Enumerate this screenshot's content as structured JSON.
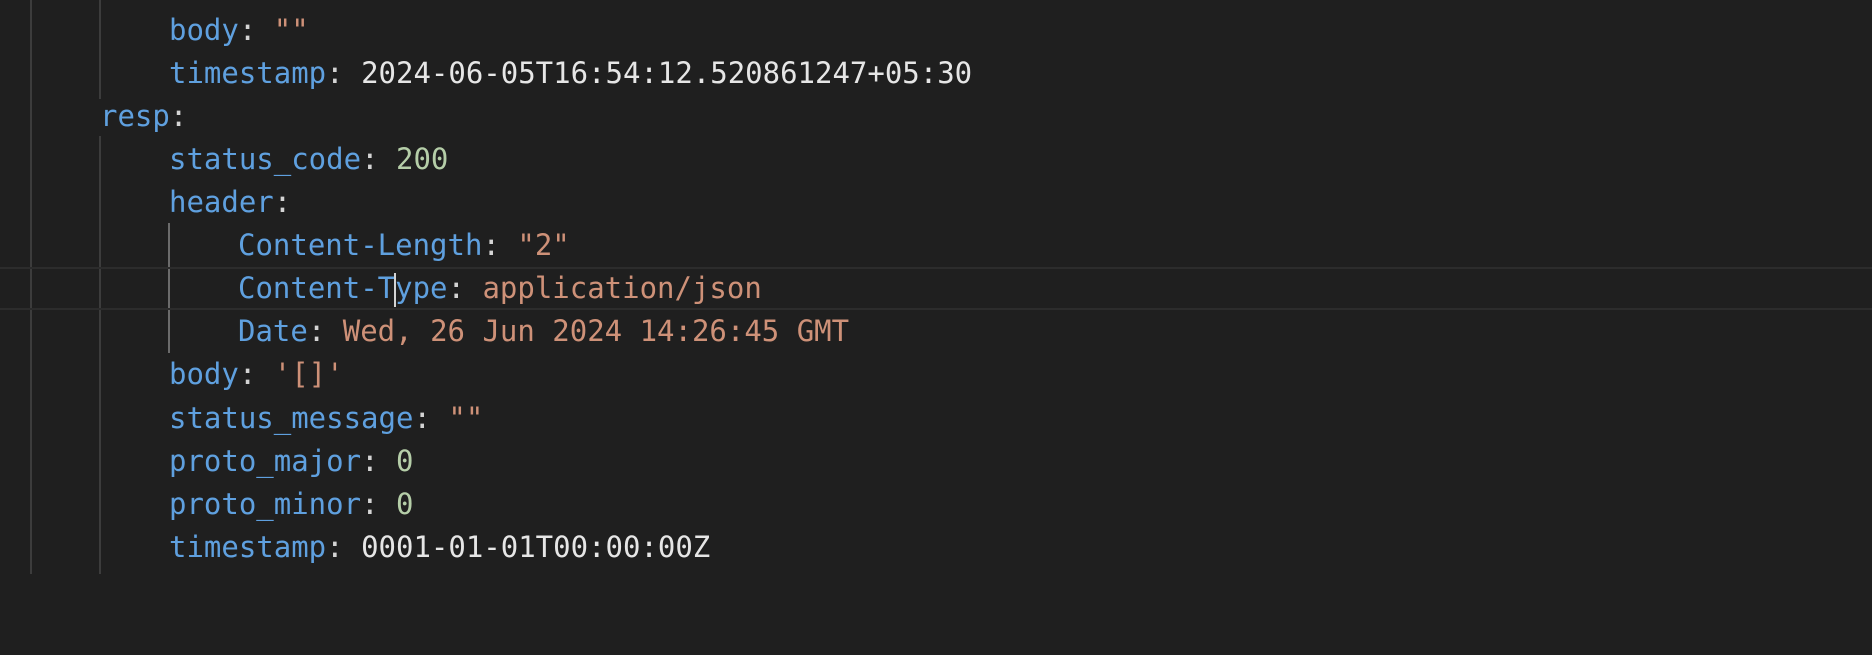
{
  "colors": {
    "background": "#1f1f1f",
    "key": "#5fa0df",
    "string": "#ce9178",
    "number": "#b5cea8",
    "punctuation": "#d4d4d4",
    "plain": "#e6e6e6"
  },
  "lines": {
    "body1": {
      "key": "body",
      "value": "\"\""
    },
    "timestamp1": {
      "key": "timestamp",
      "value": "2024-06-05T16:54:12.520861247+05:30"
    },
    "resp": {
      "key": "resp"
    },
    "status_code": {
      "key": "status_code",
      "value": "200"
    },
    "header": {
      "key": "header"
    },
    "content_length": {
      "key": "Content-Length",
      "value": "\"2\""
    },
    "content_type": {
      "key_before_cursor": "Content-T",
      "key_after_cursor": "ype",
      "value": "application/json"
    },
    "date": {
      "key": "Date",
      "value": "Wed, 26 Jun 2024 14:26:45 GMT"
    },
    "body2": {
      "key": "body",
      "value": "'[]'"
    },
    "status_message": {
      "key": "status_message",
      "value": "\"\""
    },
    "proto_major": {
      "key": "proto_major",
      "value": "0"
    },
    "proto_minor": {
      "key": "proto_minor",
      "value": "0"
    },
    "timestamp2": {
      "key": "timestamp",
      "value": "0001-01-01T00:00:00Z"
    }
  }
}
